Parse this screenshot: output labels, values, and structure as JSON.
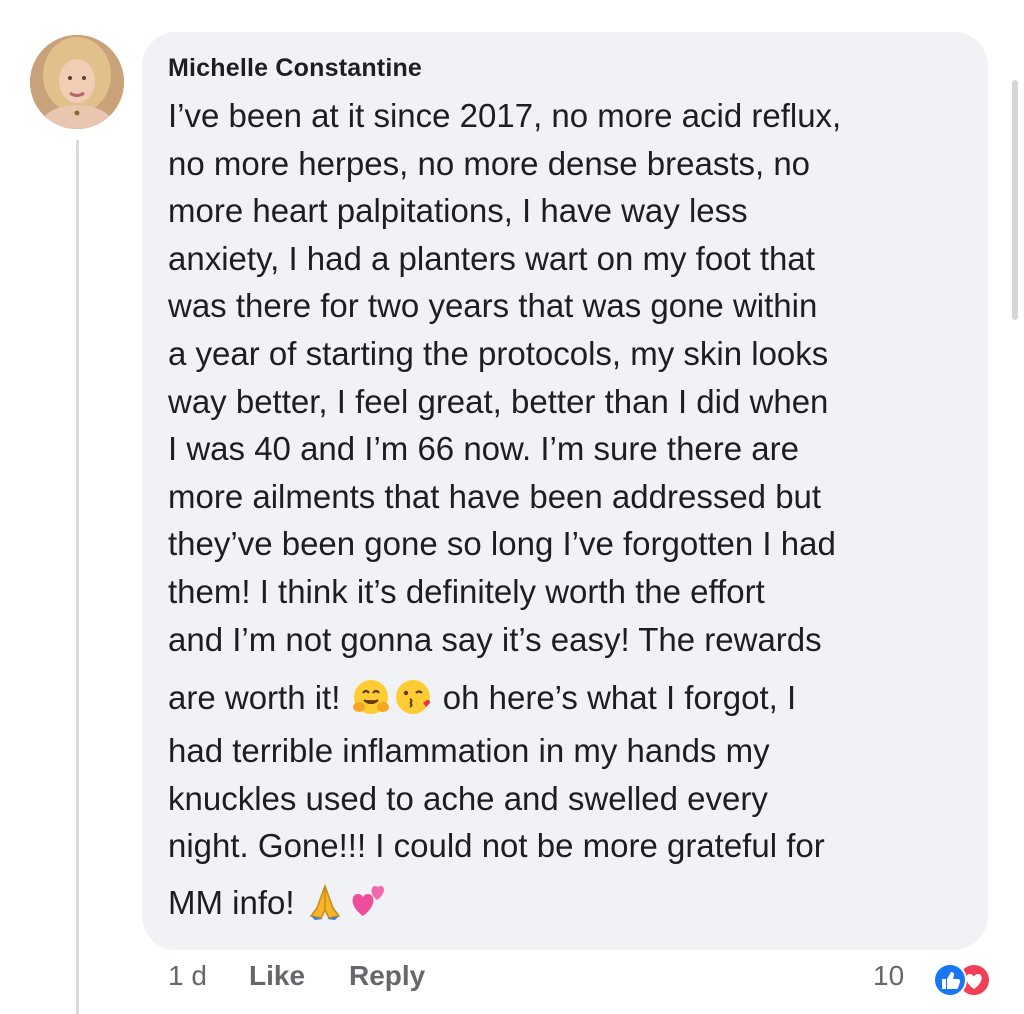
{
  "comment": {
    "author": "Michelle Constantine",
    "lines": [
      "I’ve been at it since 2017, no more acid reflux,",
      "no more herpes, no more dense breasts, no",
      "more heart palpitations, I have way less",
      "anxiety, I had a planters wart on my foot that",
      "was there for two years that was gone within",
      "a year of starting the protocols, my skin looks",
      "way better, I feel great, better than I did when",
      "I was 40 and I’m 66 now. I’m sure there are",
      "more ailments that have been addressed but",
      "they’ve been gone so long I’ve forgotten I had",
      "them! I think it’s definitely worth the effort",
      "and I’m not gonna say it’s easy! The rewards"
    ],
    "line13_before": "are worth it! ",
    "line13_after": " oh here’s what I forgot, I",
    "lines_after": [
      "had terrible inflammation in my hands my",
      "knuckles used to ache and swelled every",
      "night. Gone!!! I could not be more grateful for"
    ],
    "last_line": "MM info! ",
    "emojis": [
      "hugging-face-icon",
      "kissing-face-icon",
      "folded-hands-icon",
      "two-hearts-icon"
    ]
  },
  "footer": {
    "time": "1 d",
    "like_label": "Like",
    "reply_label": "Reply",
    "reaction_count": "10",
    "reactions": [
      "like-reaction-icon",
      "love-reaction-icon"
    ]
  },
  "colors": {
    "bubble": "#f0f2f5",
    "text": "#1c1e21",
    "muted": "#65676b",
    "like_blue": "#1877f2",
    "love_red": "#f33e58"
  }
}
